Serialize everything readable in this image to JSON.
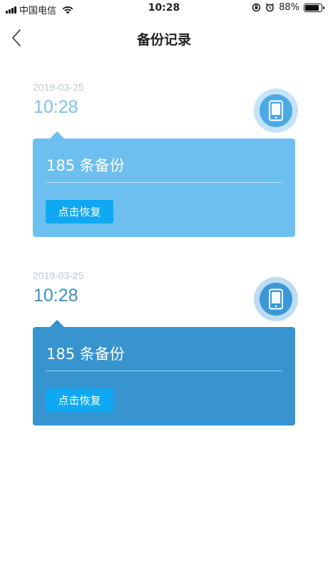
{
  "status_bar": {
    "carrier": "中国电信",
    "time": "10:28",
    "battery_percent": "88%",
    "battery_level": 0.88,
    "icons": [
      "signal-icon",
      "wifi-icon",
      "orientation-lock-icon",
      "alarm-icon",
      "battery-icon"
    ]
  },
  "nav": {
    "title": "备份记录",
    "back_icon": "chevron-left-icon"
  },
  "colors": {
    "record1_accent": "#6dbff0",
    "record1_time": "#7ac3ec",
    "record2_accent": "#3794cf",
    "record2_time": "#3f90c6",
    "restore_button": "#0fa8f2"
  },
  "records": [
    {
      "date": "2019-03-25",
      "time": "10:28",
      "count_label": "185 条备份",
      "restore_label": "点击恢复",
      "icon": "phone-icon"
    },
    {
      "date": "2019-03-25",
      "time": "10:28",
      "count_label": "185 条备份",
      "restore_label": "点击恢复",
      "icon": "phone-icon"
    }
  ]
}
